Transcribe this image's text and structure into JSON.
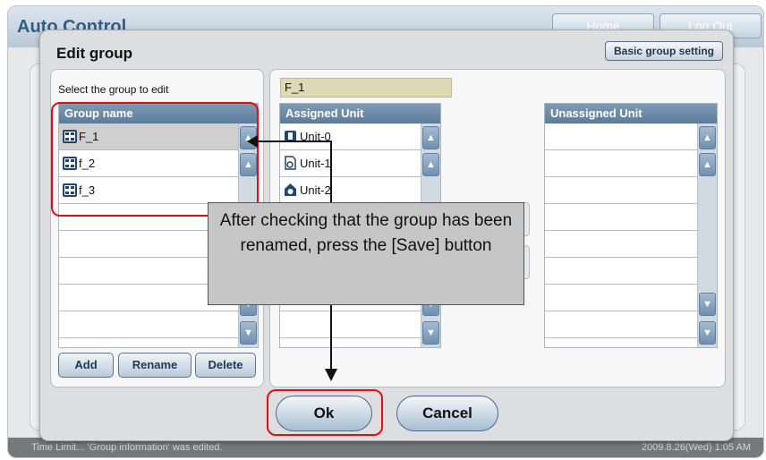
{
  "app": {
    "title": "Auto Control",
    "home_label": "Home",
    "logout_label": "Log Out",
    "status_text": "Time Limit... 'Group information' was edited.",
    "status_time": "2009.8.26(Wed)  1:05 AM"
  },
  "dialog": {
    "title": "Edit group",
    "basic_group_setting_label": "Basic group setting",
    "select_label": "Select the group to edit",
    "group_list": {
      "header": "Group name",
      "rows": [
        "F_1",
        "f_2",
        "f_3"
      ],
      "selected_index": 0
    },
    "group_name_value": "F_1",
    "assigned": {
      "header": "Assigned Unit",
      "rows": [
        {
          "label": "Unit-0",
          "icon": "indoor-unit-icon"
        },
        {
          "label": "Unit-1",
          "icon": "ventilation-unit-icon"
        },
        {
          "label": "Unit-2",
          "icon": "air-handler-icon"
        }
      ]
    },
    "unassigned": {
      "header": "Unassigned Unit",
      "rows": []
    },
    "buttons": {
      "add": "Add",
      "rename": "Rename",
      "delete": "Delete",
      "ok": "Ok",
      "cancel": "Cancel"
    }
  },
  "annotation": {
    "callout_text": "After checking that the group has been renamed, press the [Save] button",
    "highlight_color": "#e10e17"
  }
}
